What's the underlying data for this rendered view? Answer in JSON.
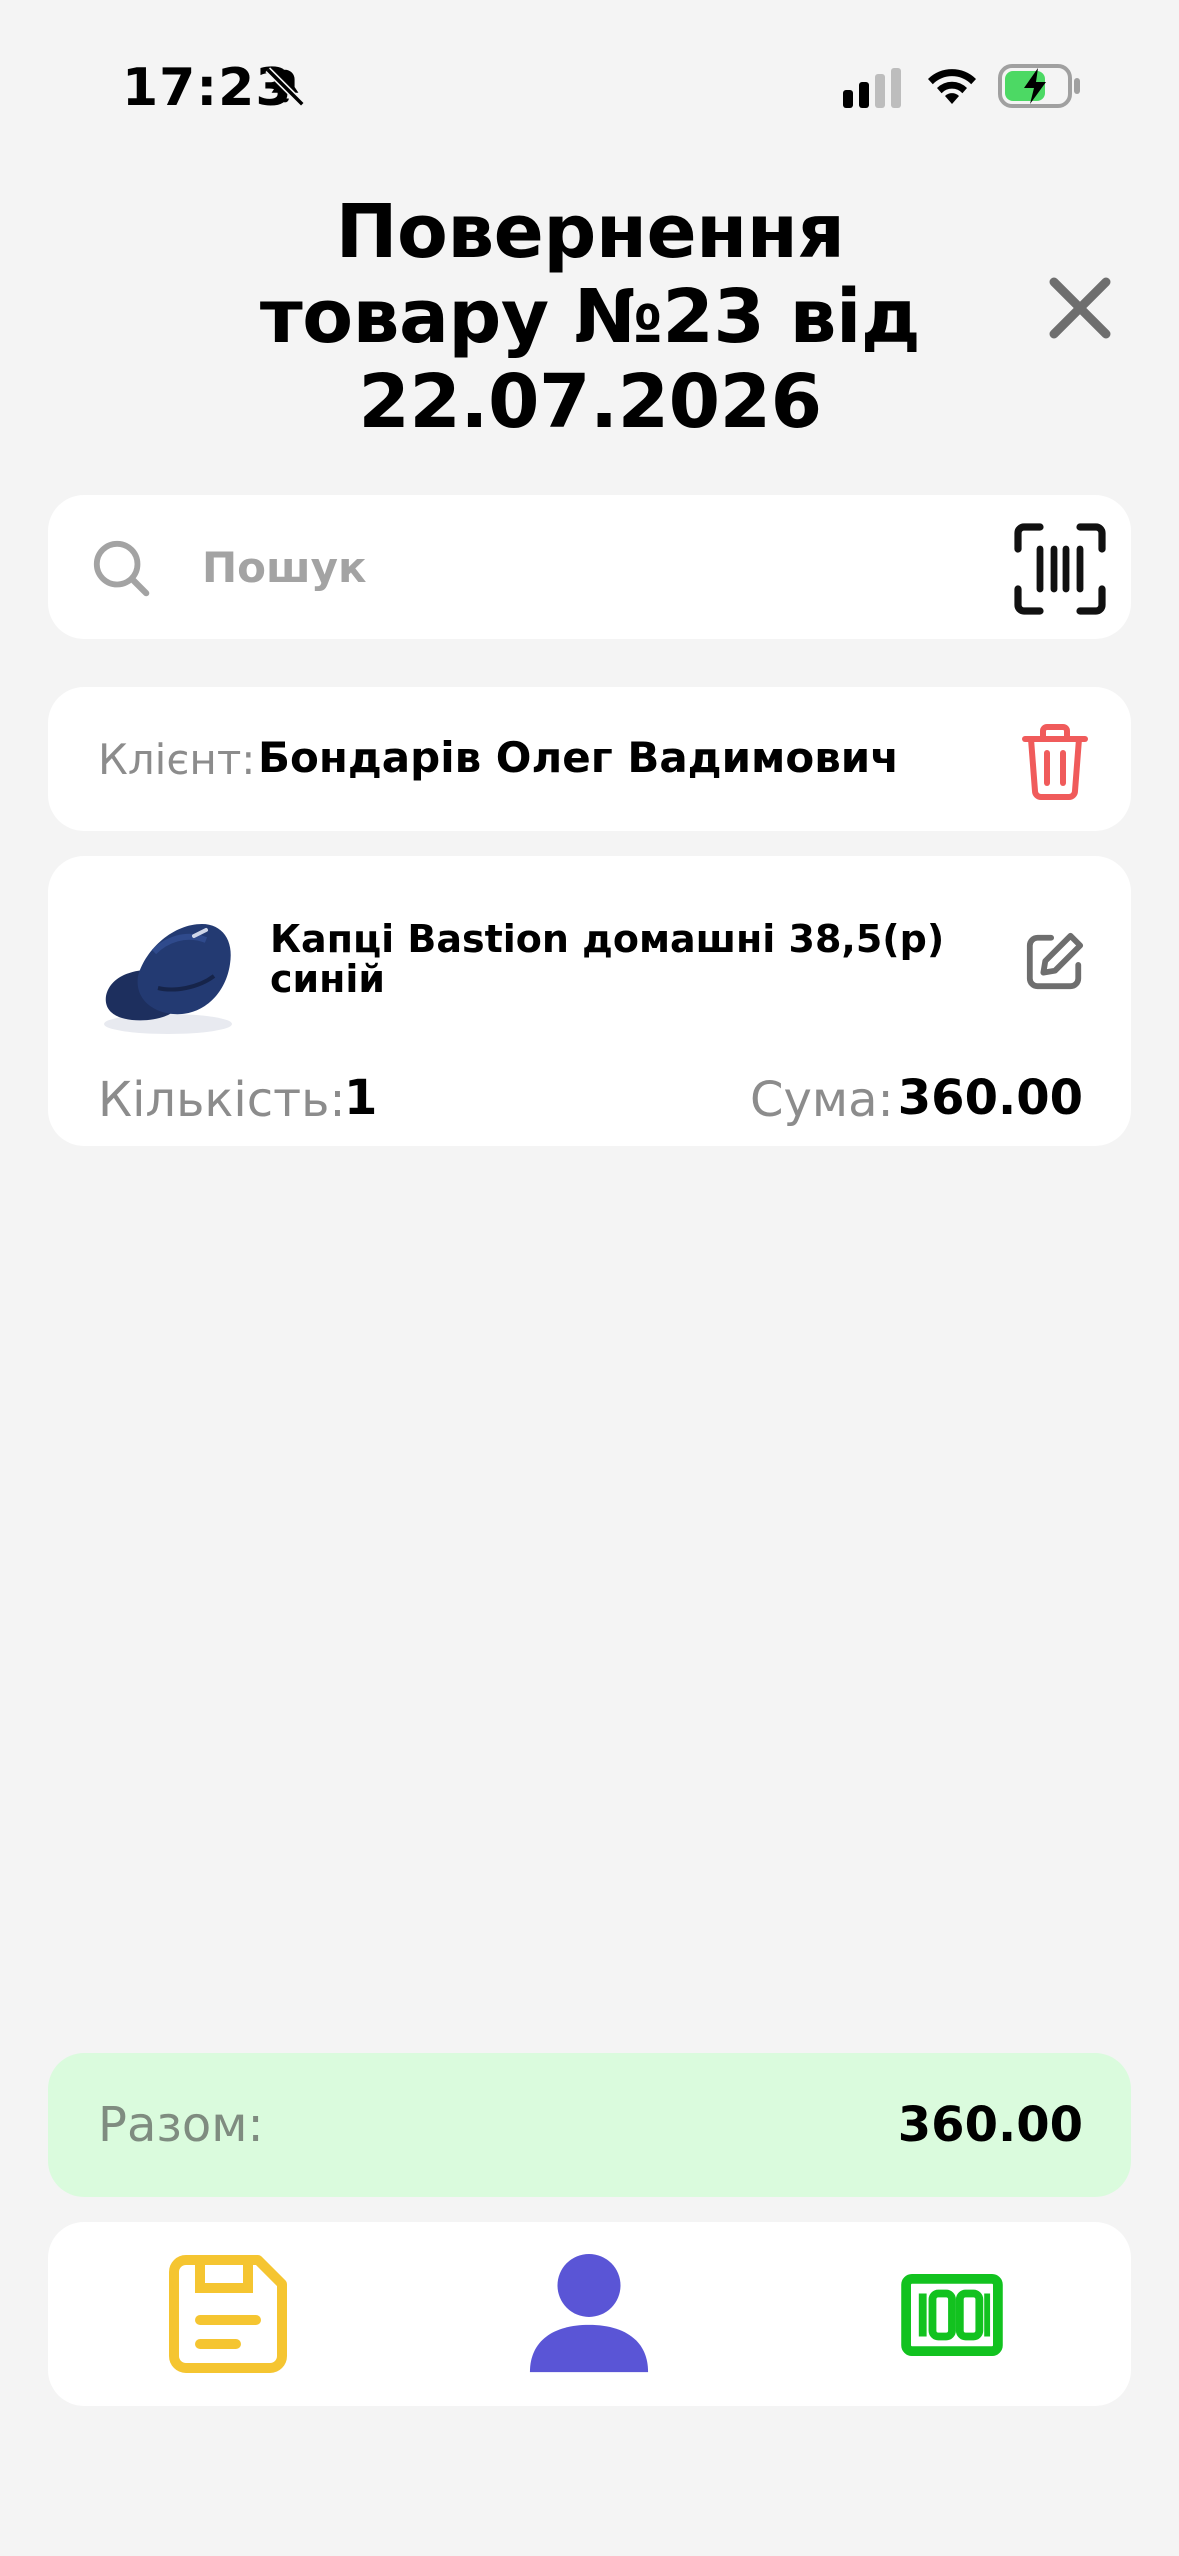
{
  "status_bar": {
    "time": "17:23"
  },
  "header": {
    "title": "Повернення\nтовару №23 від\n22.07.2026"
  },
  "search": {
    "placeholder": "Пошук",
    "value": ""
  },
  "client": {
    "label": "Клієнт:",
    "name": "Бондарів Олег Вадимович"
  },
  "product": {
    "name": "Капці Bastion домашні 38,5(р) синій",
    "qty_label": "Кількість:",
    "qty_value": "1",
    "sum_label": "Сума:",
    "sum_value": "360.00"
  },
  "total": {
    "label": "Разом:",
    "value": "360.00"
  },
  "colors": {
    "accent_save": "#f5c531",
    "accent_client": "#5a55d6",
    "accent_barcode": "#12c21f",
    "delete": "#f05b5b",
    "total_bg": "#dafbdd"
  },
  "icons": [
    "silent-bell-icon",
    "signal-icon",
    "wifi-icon",
    "battery-charging-icon",
    "close-icon",
    "search-icon",
    "barcode-scan-icon",
    "trash-icon",
    "edit-icon",
    "save-icon",
    "person-icon",
    "barcode-icon"
  ]
}
